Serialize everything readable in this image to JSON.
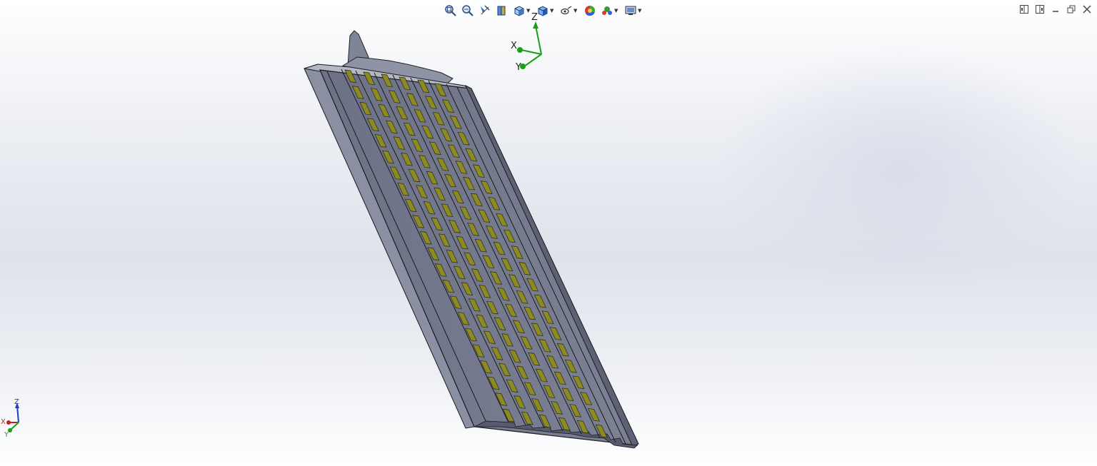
{
  "toolbar": {
    "items": [
      {
        "icon": "zoom-to-fit-icon",
        "has_menu": false
      },
      {
        "icon": "zoom-to-area-icon",
        "has_menu": false
      },
      {
        "icon": "previous-view-icon",
        "has_menu": false
      },
      {
        "icon": "section-view-icon",
        "has_menu": false
      },
      {
        "icon": "view-orientation-icon",
        "has_menu": true
      },
      {
        "icon": "display-style-icon",
        "has_menu": true
      },
      {
        "icon": "hide-show-items-icon",
        "has_menu": true
      },
      {
        "icon": "edit-appearance-icon",
        "has_menu": false
      },
      {
        "icon": "apply-scene-icon",
        "has_menu": true
      },
      {
        "icon": "view-settings-icon",
        "has_menu": true
      }
    ]
  },
  "window_controls": [
    "tile-horizontal-icon",
    "tile-vertical-icon",
    "minimize-icon",
    "restore-icon",
    "close-icon"
  ],
  "triad_labels": {
    "z": "Z",
    "x": "X",
    "y": "Y"
  },
  "colors": {
    "part_face": "#72778a",
    "part_face_light": "#8a8fa3",
    "contact_pad": "#8c8a22",
    "triad_green": "#19a019",
    "triad_red": "#c81e1e",
    "triad_blue": "#1e3cc8"
  }
}
